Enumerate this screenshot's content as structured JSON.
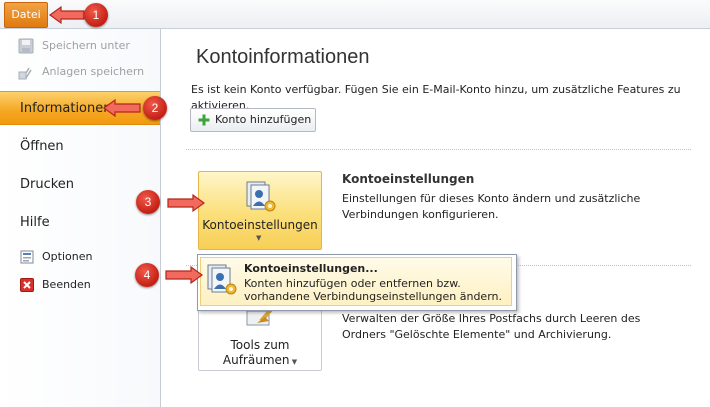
{
  "topbar": {
    "file_tab": "Datei"
  },
  "sidebar": {
    "save_as": "Speichern unter",
    "save_attachments": "Anlagen speichern",
    "info": "Informationen",
    "open": "Öffnen",
    "print": "Drucken",
    "help": "Hilfe",
    "options": "Optionen",
    "exit": "Beenden"
  },
  "main": {
    "title": "Kontoinformationen",
    "intro": "Es ist kein Konto verfügbar. Fügen Sie ein E-Mail-Konto hinzu, um zusätzliche Features zu aktivieren.",
    "add_account": "Konto hinzufügen",
    "settings_button": "Kontoeinstellungen",
    "settings_heading": "Kontoeinstellungen",
    "settings_desc": "Einstellungen für dieses Konto ändern und zusätzliche Verbindungen konfigurieren.",
    "tools_line1": "Tools zum",
    "tools_line2": "Aufräumen",
    "tools_desc": "Verwalten der Größe Ihres Postfachs durch Leeren des Ordners \"Gelöschte Elemente\" und Archivierung."
  },
  "dropdown": {
    "item_title": "Kontoeinstellungen...",
    "item_desc": "Konten hinzufügen oder entfernen bzw. vorhandene Verbindungseinstellungen ändern."
  },
  "steps": [
    "1",
    "2",
    "3",
    "4"
  ],
  "colors": {
    "accent_orange": "#f5a623",
    "badge_red": "#d12b1f",
    "highlight_yellow": "#fbdf7a"
  },
  "icons": [
    "save-as-icon",
    "save-attachments-icon",
    "plus-icon",
    "account-settings-icon",
    "cleanup-tools-icon",
    "options-icon",
    "exit-icon",
    "red-arrow-icon"
  ]
}
